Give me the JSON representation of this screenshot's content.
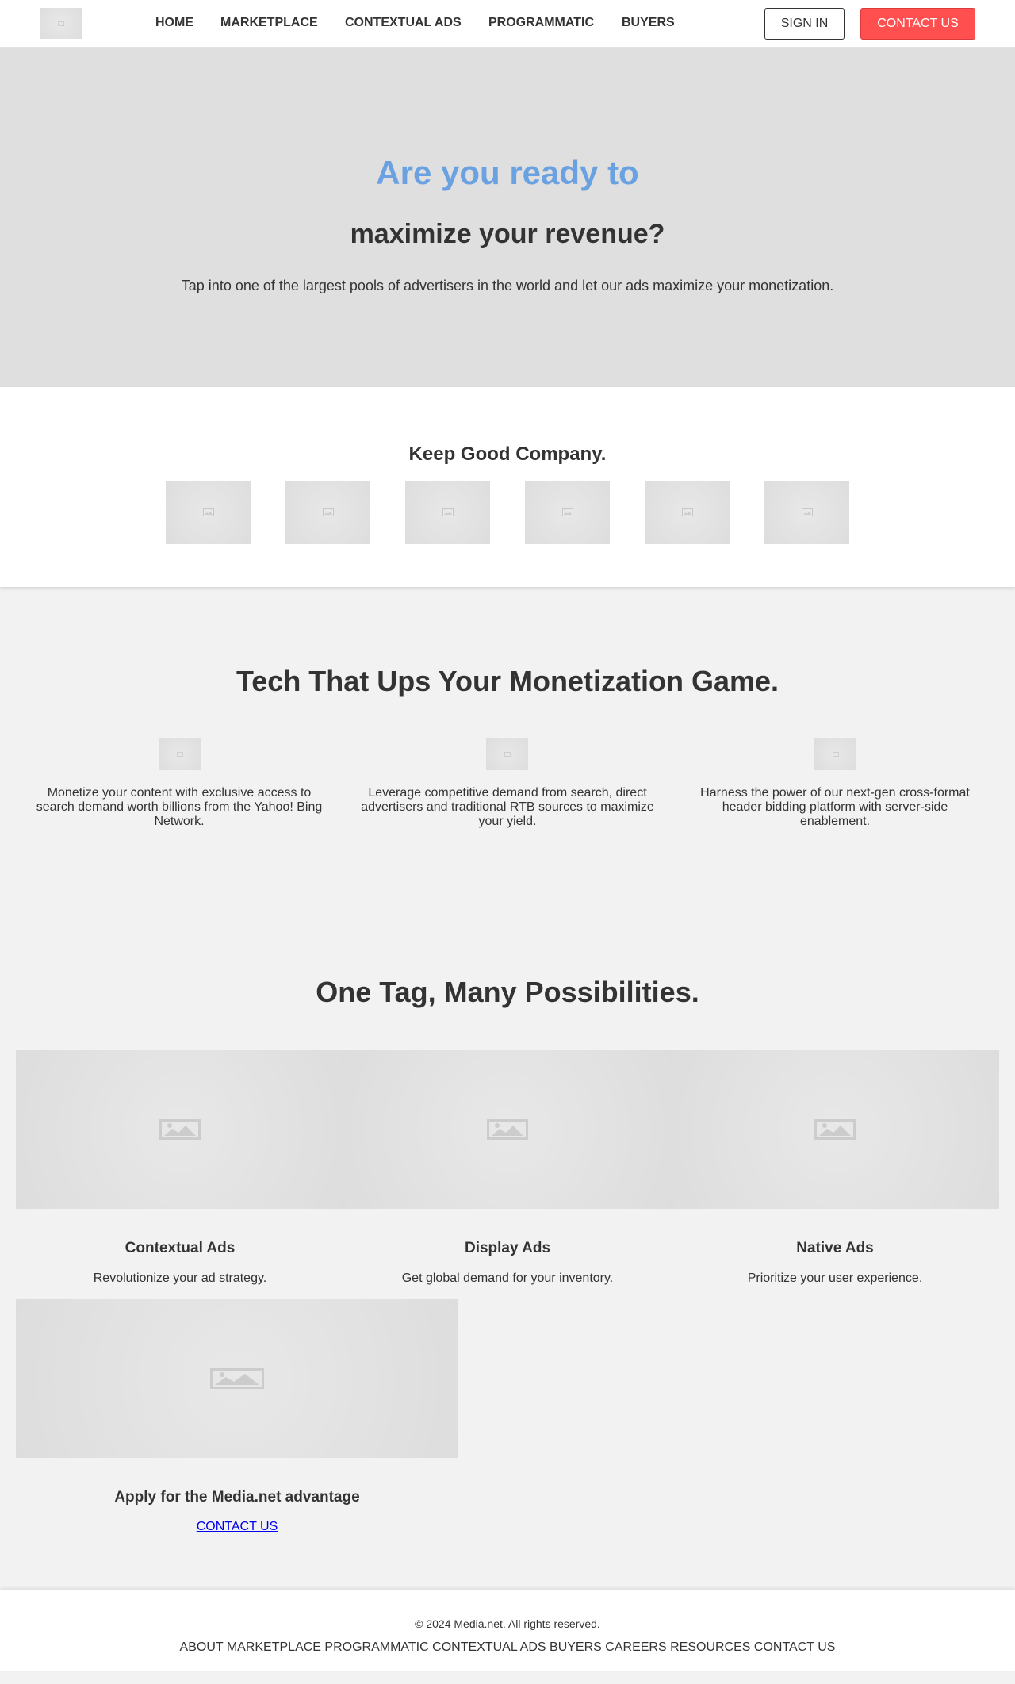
{
  "header": {
    "nav": [
      {
        "label": "HOME"
      },
      {
        "label": "MARKETPLACE"
      },
      {
        "label": "CONTEXTUAL ADS"
      },
      {
        "label": "PROGRAMMATIC"
      },
      {
        "label": "BUYERS"
      }
    ],
    "sign_in_label": "SIGN IN",
    "contact_label": "CONTACT US"
  },
  "hero": {
    "line1": "Are you ready to",
    "line2": "maximize your revenue?",
    "subtitle": "Tap into one of the largest pools of advertisers in the world and let our ads maximize your monetization."
  },
  "partners": {
    "title": "Keep Good Company."
  },
  "tech": {
    "title": "Tech That Ups Your Monetization Game.",
    "features": [
      {
        "text": "Monetize your content with exclusive access to search demand worth billions from the Yahoo! Bing Network."
      },
      {
        "text": "Leverage competitive demand from search, direct advertisers and traditional RTB sources to maximize your yield."
      },
      {
        "text": "Harness the power of our next-gen cross-format header bidding platform with server-side enablement."
      }
    ]
  },
  "products": {
    "title": "One Tag, Many Possibilities.",
    "items": [
      {
        "title": "Contextual Ads",
        "desc": "Revolutionize your ad strategy."
      },
      {
        "title": "Display Ads",
        "desc": "Get global demand for your inventory."
      },
      {
        "title": "Native Ads",
        "desc": "Prioritize your user experience."
      }
    ],
    "apply": {
      "title": "Apply for the Media.net advantage",
      "link": "CONTACT US"
    }
  },
  "footer": {
    "copyright": "© 2024 Media.net. All rights reserved.",
    "links": [
      {
        "label": "ABOUT"
      },
      {
        "label": "MARKETPLACE"
      },
      {
        "label": "PROGRAMMATIC"
      },
      {
        "label": "CONTEXTUAL ADS"
      },
      {
        "label": "BUYERS"
      },
      {
        "label": "CAREERS"
      },
      {
        "label": "RESOURCES"
      },
      {
        "label": "CONTACT US"
      }
    ]
  },
  "colors": {
    "accent_blue": "#6aa1e0",
    "contact_red": "#ff4f4f",
    "hero_bg": "#dfdfdf",
    "page_bg": "#f2f2f2"
  }
}
